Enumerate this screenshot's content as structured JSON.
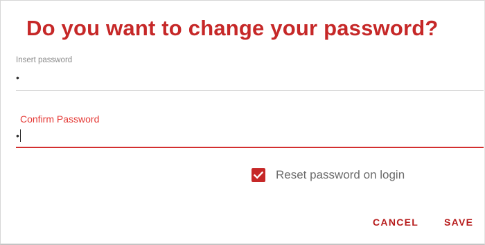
{
  "dialog": {
    "title": "Do you want to change your password?"
  },
  "fields": {
    "insert_password": {
      "label": "Insert password",
      "value": "•"
    },
    "confirm_password": {
      "label": "Confirm Password",
      "value": "•"
    }
  },
  "options": {
    "reset_on_login": {
      "label": "Reset password on login",
      "checked": true
    }
  },
  "actions": {
    "cancel_label": "CANCEL",
    "save_label": "SAVE"
  },
  "colors": {
    "accent": "#c62828",
    "focus": "#e53935",
    "label_muted": "#8a8a8a",
    "text_muted": "#6b6b6b"
  },
  "icons": {
    "checkbox": "check-icon"
  }
}
